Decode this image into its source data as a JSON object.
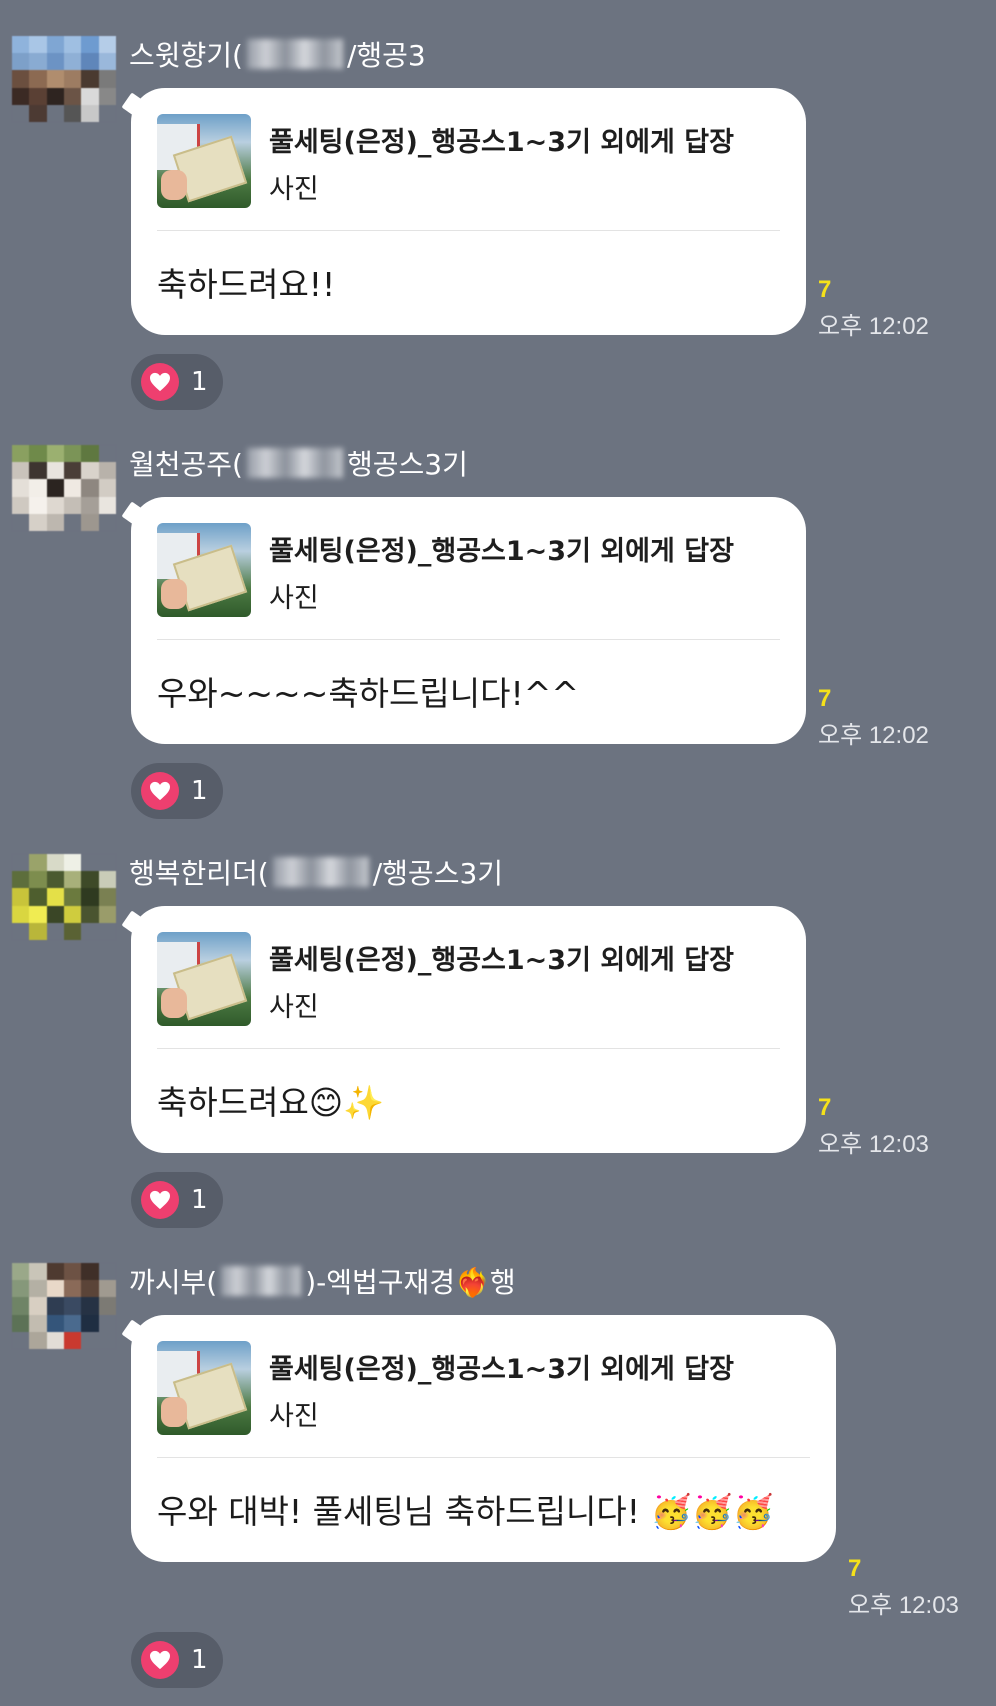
{
  "messages": [
    {
      "sender": "스윗향기(",
      "sender_suffix": "/행공3",
      "reply_title": "풀세팅(은정)_행공스1~3기 외에게 답장",
      "reply_sub": "사진",
      "text": "축하드려요!!",
      "unread": "7",
      "time": "오후 12:02",
      "reaction_count": "1"
    },
    {
      "sender": "월천공주(",
      "sender_suffix": "행공스3기",
      "reply_title": "풀세팅(은정)_행공스1~3기 외에게 답장",
      "reply_sub": "사진",
      "text": "우와~~~~축하드립니다!^^",
      "unread": "7",
      "time": "오후 12:02",
      "reaction_count": "1"
    },
    {
      "sender": "행복한리더(",
      "sender_suffix": "/행공스3기",
      "reply_title": "풀세팅(은정)_행공스1~3기 외에게 답장",
      "reply_sub": "사진",
      "text": "축하드려요😊✨",
      "unread": "7",
      "time": "오후 12:03",
      "reaction_count": "1"
    },
    {
      "sender": "까시부(",
      "sender_suffix": ")-엑법구재경❤️‍🔥행",
      "reply_title": "풀세팅(은정)_행공스1~3기 외에게 답장",
      "reply_sub": "사진",
      "text": "우와 대박! 풀세팅님 축하드립니다! 🥳🥳🥳",
      "unread": "7",
      "time": "오후 12:03",
      "reaction_count": "1"
    }
  ],
  "icons": {
    "reaction": "heart-icon",
    "reply_thumbnail": "photo-thumbnail"
  },
  "colors": {
    "background": "#6c7380",
    "bubble": "#ffffff",
    "unread": "#f5e11a",
    "heart": "#ee3f6f"
  }
}
